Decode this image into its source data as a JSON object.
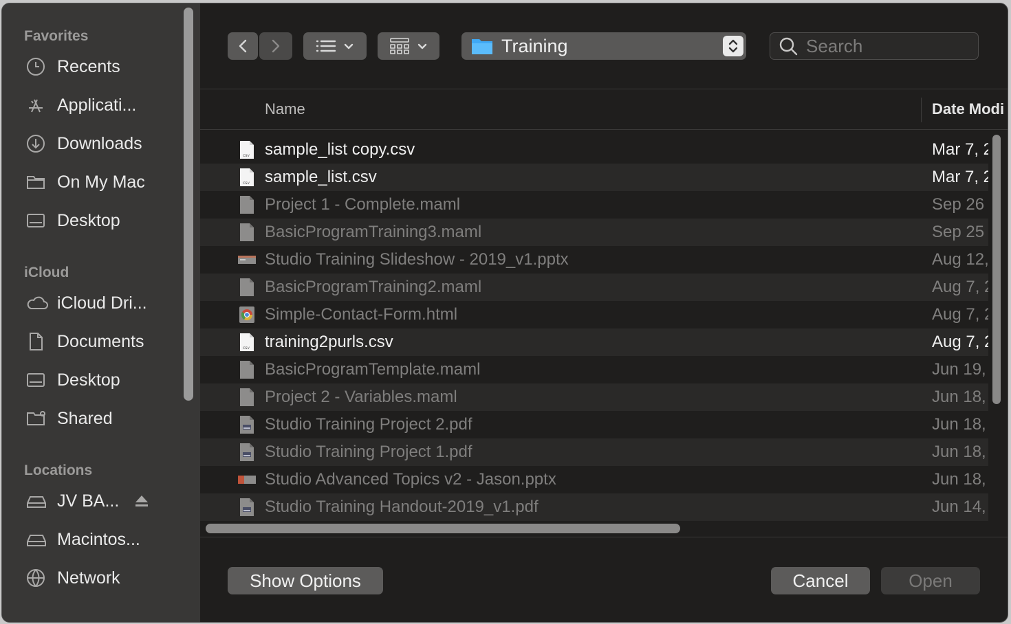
{
  "sidebar": {
    "sections": {
      "favorites": "Favorites",
      "icloud": "iCloud",
      "locations": "Locations"
    },
    "favorites": [
      {
        "label": "Recents",
        "icon": "clock-icon"
      },
      {
        "label": "Applicati...",
        "icon": "applications-icon"
      },
      {
        "label": "Downloads",
        "icon": "download-icon"
      },
      {
        "label": "On My Mac",
        "icon": "folder-icon"
      },
      {
        "label": "Desktop",
        "icon": "desktop-icon"
      }
    ],
    "icloud": [
      {
        "label": "iCloud Dri...",
        "icon": "cloud-icon"
      },
      {
        "label": "Documents",
        "icon": "document-icon"
      },
      {
        "label": "Desktop",
        "icon": "desktop-icon"
      },
      {
        "label": "Shared",
        "icon": "shared-folder-icon"
      }
    ],
    "locations": [
      {
        "label": "JV BA...",
        "icon": "drive-icon"
      },
      {
        "label": "Macintos...",
        "icon": "drive-icon"
      },
      {
        "label": "Network",
        "icon": "globe-icon"
      }
    ]
  },
  "toolbar": {
    "path_label": "Training",
    "search_placeholder": "Search"
  },
  "list": {
    "columns": {
      "name": "Name",
      "date": "Date Modi"
    },
    "files": [
      {
        "name": "sample_list copy.csv",
        "date": "Mar 7, 2",
        "icon": "csv-icon",
        "enabled": true
      },
      {
        "name": "sample_list.csv",
        "date": "Mar 7, 2",
        "icon": "csv-icon",
        "enabled": true
      },
      {
        "name": "Project 1 - Complete.maml",
        "date": "Sep 26",
        "icon": "generic-file-icon",
        "enabled": false
      },
      {
        "name": "BasicProgramTraining3.maml",
        "date": "Sep 25",
        "icon": "generic-file-icon",
        "enabled": false
      },
      {
        "name": "Studio Training Slideshow - 2019_v1.pptx",
        "date": "Aug 12,",
        "icon": "pptx-icon",
        "enabled": false
      },
      {
        "name": "BasicProgramTraining2.maml",
        "date": "Aug 7, 2",
        "icon": "generic-file-icon",
        "enabled": false
      },
      {
        "name": "Simple-Contact-Form.html",
        "date": "Aug 7, 2",
        "icon": "chrome-html-icon",
        "enabled": false
      },
      {
        "name": "training2purls.csv",
        "date": "Aug 7, 2",
        "icon": "csv-icon",
        "enabled": true
      },
      {
        "name": "BasicProgramTemplate.maml",
        "date": "Jun 19,",
        "icon": "generic-file-icon",
        "enabled": false
      },
      {
        "name": "Project 2 - Variables.maml",
        "date": "Jun 18,",
        "icon": "generic-file-icon",
        "enabled": false
      },
      {
        "name": "Studio Training Project 2.pdf",
        "date": "Jun 18,",
        "icon": "pdf-icon",
        "enabled": false
      },
      {
        "name": "Studio Training Project 1.pdf",
        "date": "Jun 18,",
        "icon": "pdf-icon",
        "enabled": false
      },
      {
        "name": "Studio Advanced Topics v2 - Jason.pptx",
        "date": "Jun 18,",
        "icon": "pptx-icon",
        "enabled": false
      },
      {
        "name": "Studio Training Handout-2019_v1.pdf",
        "date": "Jun 14,",
        "icon": "pdf-icon",
        "enabled": false
      }
    ]
  },
  "footer": {
    "show_options": "Show Options",
    "cancel": "Cancel",
    "open": "Open"
  },
  "colors": {
    "window_bg": "#1f1e1d",
    "sidebar_bg": "#383736",
    "folder_blue": "#3fa9f5"
  }
}
